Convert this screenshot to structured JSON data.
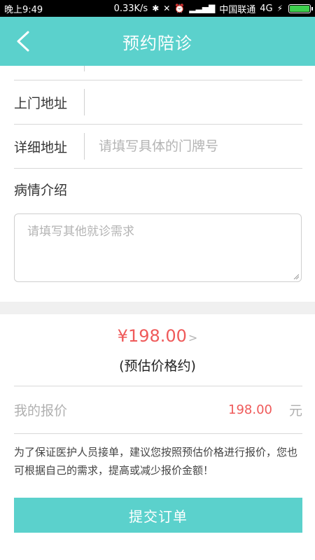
{
  "status_bar": {
    "time": "晚上9:49",
    "speed": "0.33K/s",
    "carrier": "中国联通",
    "network": "4G",
    "icons": [
      "bluetooth-icon",
      "vibrate-off-icon",
      "alarm-icon",
      "signal-icon",
      "charging-icon",
      "battery-icon"
    ]
  },
  "header": {
    "title": "预约陪诊",
    "back_icon": "chevron-left-icon"
  },
  "form": {
    "address_label": "上门地址",
    "address_value": "",
    "detail_label": "详细地址",
    "detail_placeholder": "请填写具体的门牌号",
    "condition_label": "病情介绍",
    "condition_placeholder": "请填写其他就诊需求"
  },
  "pricing": {
    "estimated_price": "¥198.00",
    "price_arrow": ">",
    "estimate_note": "(预估价格约)",
    "my_offer_label": "我的报价",
    "my_offer_value": "198.00",
    "unit": "元",
    "advice": "为了保证医护人员接单，建议您按照预估价格进行报价，您也可根据自己的需求，提高或减少报价金额！"
  },
  "submit_label": "提交订单",
  "colors": {
    "accent": "#5bd1cc",
    "price": "#ef5a5a",
    "placeholder": "#b4b4b4"
  }
}
